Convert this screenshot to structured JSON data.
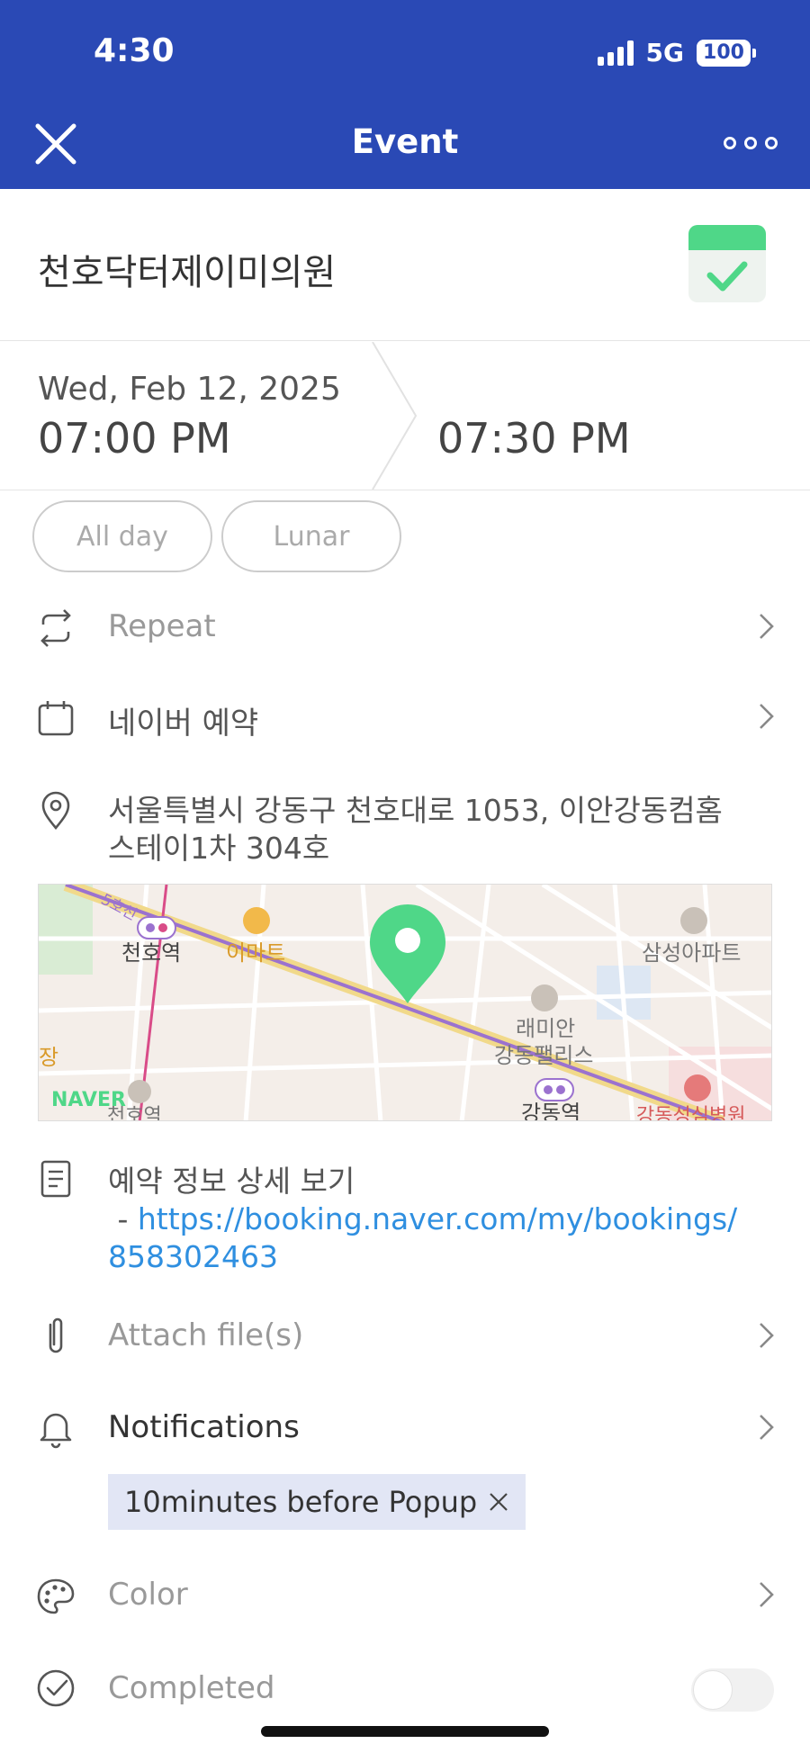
{
  "status_bar": {
    "time": "4:30",
    "network": "5G",
    "battery": "100"
  },
  "nav": {
    "title": "Event"
  },
  "event": {
    "title": "천호닥터제이미의원"
  },
  "datetime": {
    "date": "Wed, Feb 12, 2025",
    "start_time": "07:00 PM",
    "end_time": "07:30 PM"
  },
  "options": {
    "all_day": "All day",
    "lunar": "Lunar"
  },
  "rows": {
    "repeat": "Repeat",
    "calendar": "네이버 예약",
    "address": "서울특별시 강동구 천호대로 1053, 이안강동컴홈 스테이1차 304호",
    "memo_text": "예약 정보 상세 보기",
    "memo_prefix": " - ",
    "memo_link": "https://booking.naver.com/my/bookings/858302463",
    "attach": "Attach file(s)",
    "notifications": "Notifications",
    "notification_chip": "10minutes before Popup",
    "color": "Color",
    "completed": "Completed"
  },
  "map": {
    "labels": {
      "line_5": "5호선",
      "cheonho_station": "천호역",
      "emart": "이마트",
      "samsung_apt": "삼성아파트",
      "raemian": "래미안",
      "gangdong_palace": "강동팰리스",
      "gangdong_station": "강동역",
      "hospital": "강동성심병원",
      "cheonho_station_2": "천호역",
      "jang": "장",
      "naver": "NAVER"
    }
  },
  "colors": {
    "header": "#2a49b5",
    "accent_green": "#4fd788",
    "link": "#2f8fe0",
    "chip": "#e2e6f5"
  },
  "completed_on": false
}
